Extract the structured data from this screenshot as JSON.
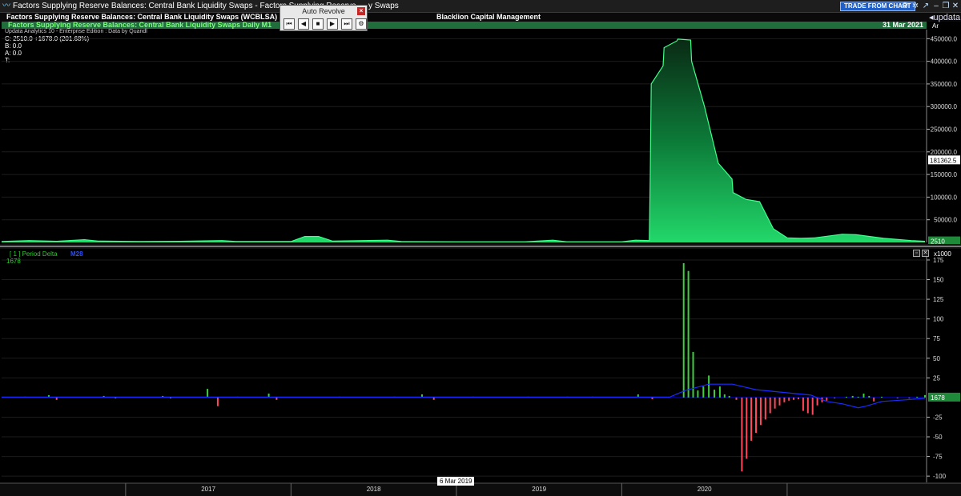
{
  "window": {
    "title": "Factors Supplying Reserve Balances: Central Bank Liquidity Swaps - Factors Supplying Reserve",
    "title_tail": "y Swaps",
    "trade_button": "TRADE FROM CHART",
    "brand": "updata"
  },
  "header": {
    "symbol_title": "Factors Supplying Reserve Balances: Central Bank Liquidity Swaps (WCBLSA)",
    "company": "Blacklion Capital Management"
  },
  "series_bar": {
    "title": "Factors Supplying Reserve Balances: Central Bank Liquidity Swaps Daily  M1",
    "date": "31 Mar 2021",
    "axis_corner": "Ar"
  },
  "info": {
    "edition": "Updata Analytics 10 - Enterprise Edition : Data by Quandl",
    "close": "C: 2510.0  +1678.0 (201.68%)",
    "bid": "B: 0.0",
    "ask": "A: 0.0",
    "time": "T:"
  },
  "dialog": {
    "title": "Auto Revolve",
    "close": "×",
    "buttons": [
      "⏮",
      "◀",
      "■",
      "▶",
      "⏭",
      "⚙"
    ]
  },
  "sub_panel": {
    "label": "[ 1 ] Period Delta",
    "ma_label": "M28",
    "value": "1678",
    "multiplier": "x1000"
  },
  "tooltip": {
    "date": "6 Mar 2019"
  },
  "icons": [
    "app-logo-icon",
    "settings-icon",
    "gear-icon",
    "share-icon",
    "minimize-icon",
    "restore-icon",
    "close-icon",
    "back-arrow-icon"
  ],
  "colors": {
    "area": "#22d86a",
    "bar_up": "#3ecf3e",
    "bar_down": "#ff4a5c",
    "ma": "#1a2cff",
    "zero_line": "#0000cc"
  },
  "chart_data": [
    {
      "type": "area",
      "x_start": "2016-04",
      "x_end": "2021-03",
      "year_labels": [
        "2017",
        "2018",
        "2019",
        "2020"
      ],
      "ylim": [
        0,
        470000
      ],
      "yticks": [
        "50000.0",
        "100000.0",
        "150000.0",
        "200000.0",
        "250000.0",
        "300000.0",
        "350000.0",
        "400000.0",
        "450000.0"
      ],
      "last_value_label": "2510",
      "cursor_value_label": "181362.5",
      "points": [
        [
          "2016-04",
          2000
        ],
        [
          "2016-06",
          4000
        ],
        [
          "2016-08",
          2500
        ],
        [
          "2016-10",
          6000
        ],
        [
          "2016-11",
          3000
        ],
        [
          "2017-02",
          2000
        ],
        [
          "2017-05",
          2500
        ],
        [
          "2017-08",
          4000
        ],
        [
          "2017-09",
          2000
        ],
        [
          "2018-01",
          2000
        ],
        [
          "2018-02",
          13000
        ],
        [
          "2018-03",
          13000
        ],
        [
          "2018-04",
          3000
        ],
        [
          "2018-08",
          5000
        ],
        [
          "2018-09",
          2000
        ],
        [
          "2019-01",
          1500
        ],
        [
          "2019-06",
          1500
        ],
        [
          "2019-08",
          5000
        ],
        [
          "2019-09",
          1500
        ],
        [
          "2020-01",
          1500
        ],
        [
          "2020-02",
          5000
        ],
        [
          "2020-03",
          4000
        ],
        [
          "2020-03",
          150000
        ],
        [
          "2020-03",
          350000
        ],
        [
          "2020-04",
          390000
        ],
        [
          "2020-04",
          430000
        ],
        [
          "2020-05",
          445000
        ],
        [
          "2020-05",
          449000
        ],
        [
          "2020-06",
          447000
        ],
        [
          "2020-06",
          400000
        ],
        [
          "2020-07",
          300000
        ],
        [
          "2020-08",
          175000
        ],
        [
          "2020-09",
          140000
        ],
        [
          "2020-09",
          110000
        ],
        [
          "2020-10",
          95000
        ],
        [
          "2020-11",
          90000
        ],
        [
          "2020-12",
          30000
        ],
        [
          "2021-01",
          10000
        ],
        [
          "2021-02",
          9000
        ],
        [
          "2021-03",
          10000
        ],
        [
          "2021-05",
          18000
        ],
        [
          "2021-06",
          17000
        ],
        [
          "2021-08",
          9000
        ],
        [
          "2021-10",
          4000
        ],
        [
          "2021-11",
          2510
        ]
      ]
    },
    {
      "type": "bar",
      "title": "Period Delta",
      "ylim": [
        -108,
        177
      ],
      "yticks": [
        "-100",
        "-75",
        "-50",
        "-25",
        "25",
        "50",
        "75",
        "100",
        "125",
        "150",
        "175"
      ],
      "multiplier": "x1000",
      "bars": [
        [
          0.03,
          1
        ],
        [
          0.06,
          3
        ],
        [
          0.07,
          -3
        ],
        [
          0.13,
          2
        ],
        [
          0.145,
          -1
        ],
        [
          0.205,
          2
        ],
        [
          0.215,
          -1
        ],
        [
          0.262,
          11
        ],
        [
          0.275,
          -11
        ],
        [
          0.3,
          1
        ],
        [
          0.34,
          5
        ],
        [
          0.35,
          -3
        ],
        [
          0.43,
          1
        ],
        [
          0.5,
          1
        ],
        [
          0.535,
          4
        ],
        [
          0.55,
          -3
        ],
        [
          0.6,
          1
        ],
        [
          0.67,
          1
        ],
        [
          0.72,
          1
        ],
        [
          0.752,
          1
        ],
        [
          0.81,
          4
        ],
        [
          0.828,
          -2
        ],
        [
          0.868,
          171
        ],
        [
          0.874,
          161
        ],
        [
          0.88,
          58
        ],
        [
          0.886,
          9
        ],
        [
          0.893,
          14
        ],
        [
          0.9,
          28
        ],
        [
          0.907,
          10
        ],
        [
          0.914,
          14
        ],
        [
          0.92,
          4
        ],
        [
          0.926,
          2
        ],
        [
          0.935,
          -3
        ],
        [
          0.942,
          -94
        ],
        [
          0.948,
          -78
        ],
        [
          0.954,
          -55
        ],
        [
          0.96,
          -45
        ],
        [
          0.966,
          -35
        ],
        [
          0.972,
          -28
        ],
        [
          0.978,
          -20
        ],
        [
          0.984,
          -14
        ],
        [
          0.99,
          -10
        ],
        [
          0.996,
          -6
        ],
        [
          1.002,
          -4
        ],
        [
          1.008,
          -3
        ],
        [
          1.014,
          -2
        ],
        [
          1.02,
          -17
        ],
        [
          1.026,
          -20
        ],
        [
          1.032,
          -22
        ],
        [
          1.038,
          -10
        ],
        [
          1.044,
          -6
        ],
        [
          1.05,
          -4
        ],
        [
          1.06,
          -1
        ],
        [
          1.075,
          1
        ],
        [
          1.083,
          2
        ],
        [
          1.09,
          1
        ],
        [
          1.097,
          5
        ],
        [
          1.104,
          2
        ],
        [
          1.11,
          -5
        ],
        [
          1.12,
          1
        ],
        [
          1.14,
          -1
        ],
        [
          1.155,
          -1
        ],
        [
          1.165,
          1
        ],
        [
          1.175,
          3
        ]
      ],
      "ma_points": [
        [
          0.0,
          0.5
        ],
        [
          0.85,
          0.5
        ],
        [
          0.87,
          9
        ],
        [
          0.9,
          17
        ],
        [
          0.93,
          17
        ],
        [
          0.96,
          10
        ],
        [
          1.0,
          6
        ],
        [
          1.03,
          3
        ],
        [
          1.05,
          -5
        ],
        [
          1.07,
          -8
        ],
        [
          1.09,
          -13
        ],
        [
          1.1,
          -11
        ],
        [
          1.12,
          -5
        ],
        [
          1.15,
          -3
        ],
        [
          1.175,
          -1
        ]
      ]
    }
  ]
}
